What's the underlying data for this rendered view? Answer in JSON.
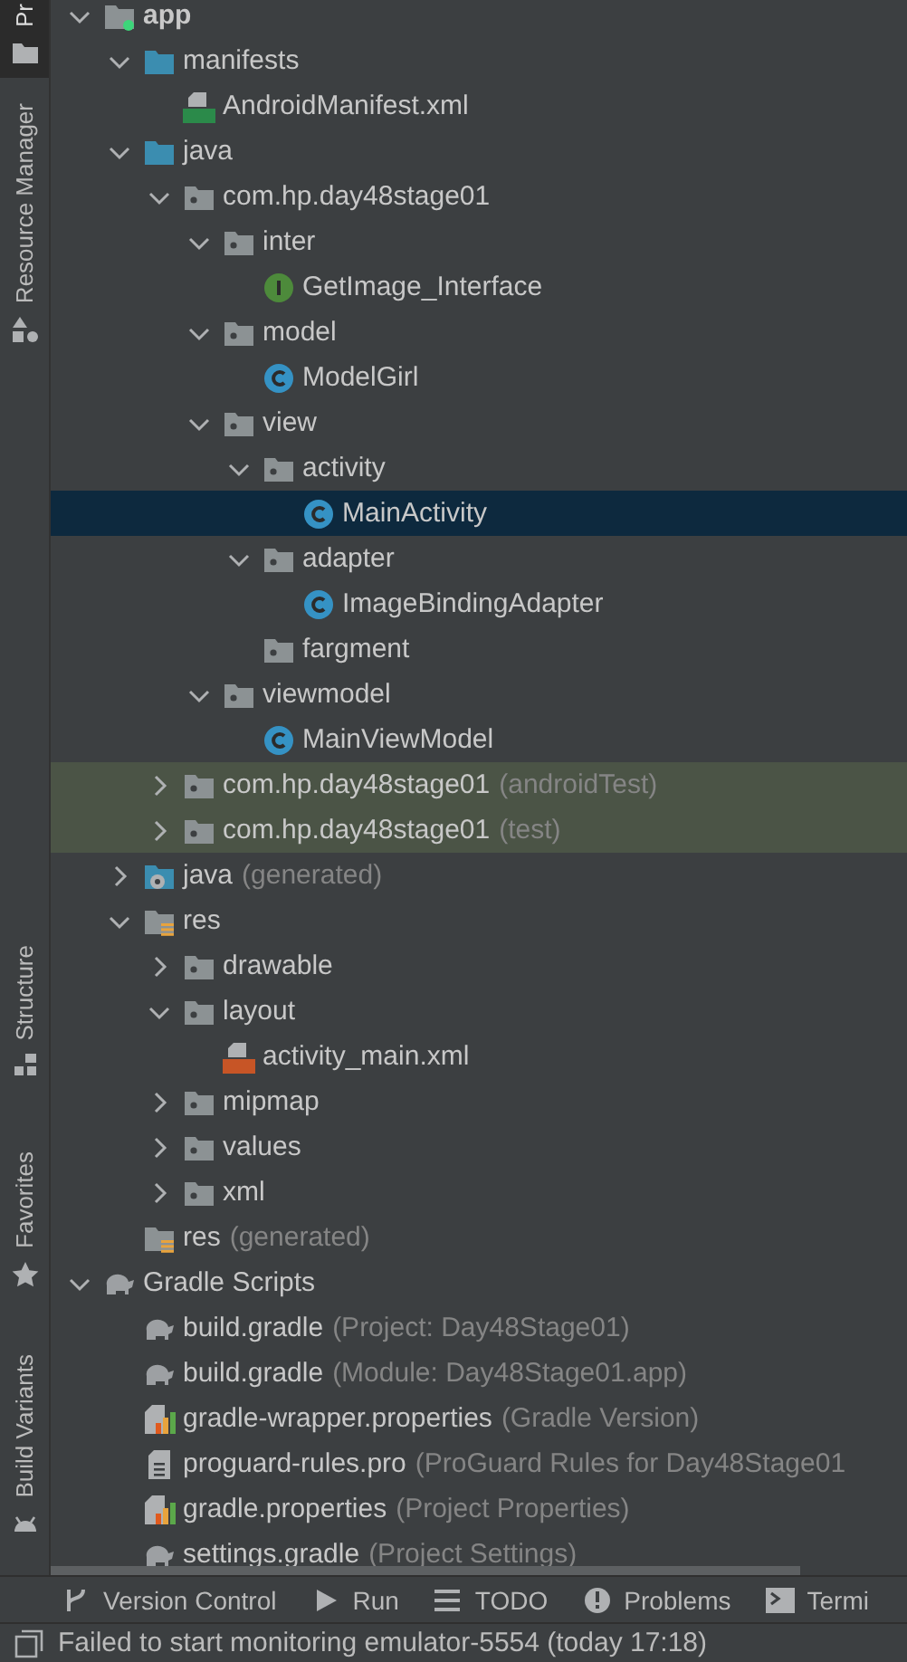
{
  "side_tabs": [
    {
      "label": "Pr",
      "kind": "project",
      "selected": true
    },
    {
      "label": "Resource Manager",
      "kind": "resources",
      "selected": false
    },
    {
      "label": "Structure",
      "kind": "structure",
      "selected": false
    },
    {
      "label": "Favorites",
      "kind": "favorites",
      "selected": false
    },
    {
      "label": "Build Variants",
      "kind": "variants",
      "selected": false
    }
  ],
  "tree": [
    {
      "name": "app",
      "kind": "module",
      "expanded": true,
      "selected": false,
      "tinted": false,
      "children": [
        {
          "name": "manifests",
          "kind": "folder",
          "expanded": true,
          "selected": false,
          "tinted": false,
          "children": [
            {
              "name": "AndroidManifest.xml",
              "kind": "manifest",
              "selected": false,
              "tinted": false
            }
          ]
        },
        {
          "name": "java",
          "kind": "folder",
          "expanded": true,
          "selected": false,
          "tinted": false,
          "children": [
            {
              "name": "com.hp.day48stage01",
              "kind": "package",
              "expanded": true,
              "selected": false,
              "tinted": false,
              "children": [
                {
                  "name": "inter",
                  "kind": "package",
                  "expanded": true,
                  "selected": false,
                  "tinted": false,
                  "children": [
                    {
                      "name": "GetImage_Interface",
                      "kind": "interface",
                      "selected": false,
                      "tinted": false
                    }
                  ]
                },
                {
                  "name": "model",
                  "kind": "package",
                  "expanded": true,
                  "selected": false,
                  "tinted": false,
                  "children": [
                    {
                      "name": "ModelGirl",
                      "kind": "class",
                      "selected": false,
                      "tinted": false
                    }
                  ]
                },
                {
                  "name": "view",
                  "kind": "package",
                  "expanded": true,
                  "selected": false,
                  "tinted": false,
                  "children": [
                    {
                      "name": "activity",
                      "kind": "package",
                      "expanded": true,
                      "selected": false,
                      "tinted": false,
                      "children": [
                        {
                          "name": "MainActivity",
                          "kind": "class",
                          "selected": true,
                          "tinted": false
                        }
                      ]
                    },
                    {
                      "name": "adapter",
                      "kind": "package",
                      "expanded": true,
                      "selected": false,
                      "tinted": false,
                      "children": [
                        {
                          "name": "ImageBindingAdapter",
                          "kind": "class",
                          "selected": false,
                          "tinted": false
                        }
                      ]
                    },
                    {
                      "name": "fargment",
                      "kind": "package",
                      "selected": false,
                      "tinted": false
                    }
                  ]
                },
                {
                  "name": "viewmodel",
                  "kind": "package",
                  "expanded": true,
                  "selected": false,
                  "tinted": false,
                  "children": [
                    {
                      "name": "MainViewModel",
                      "kind": "class",
                      "selected": false,
                      "tinted": false
                    }
                  ]
                }
              ]
            },
            {
              "name": "com.hp.day48stage01",
              "suffix": "(androidTest)",
              "kind": "package",
              "expanded": false,
              "selected": false,
              "tinted": true
            },
            {
              "name": "com.hp.day48stage01",
              "suffix": "(test)",
              "kind": "package",
              "expanded": false,
              "selected": false,
              "tinted": true
            }
          ]
        },
        {
          "name": "java",
          "suffix": "(generated)",
          "kind": "generated",
          "expanded": false,
          "selected": false,
          "tinted": false
        },
        {
          "name": "res",
          "kind": "res",
          "expanded": true,
          "selected": false,
          "tinted": false,
          "children": [
            {
              "name": "drawable",
              "kind": "package",
              "expanded": false,
              "selected": false,
              "tinted": false
            },
            {
              "name": "layout",
              "kind": "package",
              "expanded": true,
              "selected": false,
              "tinted": false,
              "children": [
                {
                  "name": "activity_main.xml",
                  "kind": "layout",
                  "selected": false,
                  "tinted": false
                }
              ]
            },
            {
              "name": "mipmap",
              "kind": "package",
              "expanded": false,
              "selected": false,
              "tinted": false
            },
            {
              "name": "values",
              "kind": "package",
              "expanded": false,
              "selected": false,
              "tinted": false
            },
            {
              "name": "xml",
              "kind": "package",
              "expanded": false,
              "selected": false,
              "tinted": false
            }
          ]
        },
        {
          "name": "res",
          "suffix": "(generated)",
          "kind": "res",
          "selected": false,
          "tinted": false
        }
      ]
    },
    {
      "name": "Gradle Scripts",
      "kind": "gradle",
      "expanded": true,
      "selected": false,
      "tinted": false,
      "children": [
        {
          "name": "build.gradle",
          "suffix": "(Project: Day48Stage01)",
          "kind": "gradle",
          "selected": false,
          "tinted": false
        },
        {
          "name": "build.gradle",
          "suffix": "(Module: Day48Stage01.app)",
          "kind": "gradle",
          "selected": false,
          "tinted": false
        },
        {
          "name": "gradle-wrapper.properties",
          "suffix": "(Gradle Version)",
          "kind": "properties",
          "selected": false,
          "tinted": false
        },
        {
          "name": "proguard-rules.pro",
          "suffix": "(ProGuard Rules for Day48Stage01",
          "kind": "text",
          "selected": false,
          "tinted": false
        },
        {
          "name": "gradle.properties",
          "suffix": "(Project Properties)",
          "kind": "properties",
          "selected": false,
          "tinted": false
        },
        {
          "name": "settings.gradle",
          "suffix": "(Project Settings)",
          "kind": "gradle",
          "selected": false,
          "tinted": false
        }
      ]
    }
  ],
  "tool_tabs": [
    {
      "label": "Version Control",
      "kind": "vcs"
    },
    {
      "label": "Run",
      "kind": "run"
    },
    {
      "label": "TODO",
      "kind": "todo"
    },
    {
      "label": "Problems",
      "kind": "problems"
    },
    {
      "label": "Termi",
      "kind": "terminal"
    }
  ],
  "status_bar": {
    "message": "Failed to start monitoring emulator-5554 (today 17:18)"
  }
}
